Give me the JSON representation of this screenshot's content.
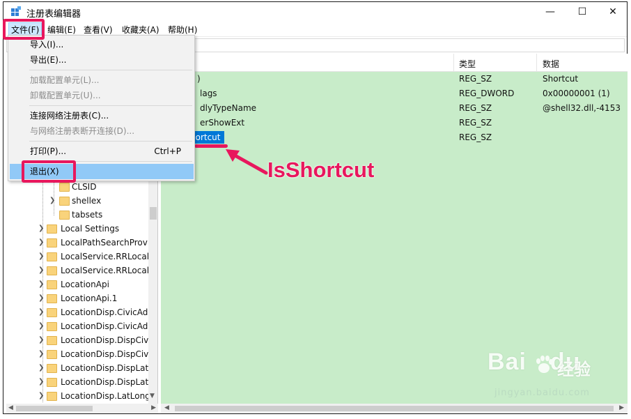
{
  "window": {
    "title": "注册表编辑器",
    "controls": {
      "minimize": "—",
      "maximize": "☐",
      "close": "✕"
    }
  },
  "menubar": {
    "items": [
      "文件(F)",
      "编辑(E)",
      "查看(V)",
      "收藏夹(A)",
      "帮助(H)"
    ]
  },
  "file_menu": {
    "items": [
      {
        "label": "导入(I)...",
        "enabled": true
      },
      {
        "label": "导出(E)...",
        "enabled": true
      },
      {
        "label": "加载配置单元(L)...",
        "enabled": false
      },
      {
        "label": "卸载配置单元(U)...",
        "enabled": false
      },
      {
        "label": "连接网络注册表(C)...",
        "enabled": true
      },
      {
        "label": "与网络注册表断开连接(D)...",
        "enabled": false
      },
      {
        "label": "打印(P)...",
        "enabled": true,
        "shortcut": "Ctrl+P"
      },
      {
        "label": "退出(X)",
        "enabled": true,
        "highlighted": true
      }
    ]
  },
  "tree": {
    "items": [
      "CLSID",
      "shellex",
      "tabsets",
      "Local Settings",
      "LocalPathSearchProvi",
      "LocalService.RRLocalS",
      "LocalService.RRLocalS",
      "LocationApi",
      "LocationApi.1",
      "LocationDisp.CivicAdc",
      "LocationDisp.CivicAdc",
      "LocationDisp.DispCivi",
      "LocationDisp.DispCivi",
      "LocationDisp.DispLatL",
      "LocationDisp.DispLatL",
      "LocationDisp.LatLong"
    ]
  },
  "values": {
    "columns": {
      "type": "类型",
      "data": "数据"
    },
    "rows": [
      {
        "name_fragment": ")",
        "type": "REG_SZ",
        "data": "Shortcut"
      },
      {
        "name_fragment": "lags",
        "type": "REG_DWORD",
        "data": "0x00000001 (1)"
      },
      {
        "name_fragment": "dlyTypeName",
        "type": "REG_SZ",
        "data": "@shell32.dll,-4153"
      },
      {
        "name_fragment": "erShowExt",
        "type": "REG_SZ",
        "data": ""
      },
      {
        "name_fragment": "hortcut",
        "type": "REG_SZ",
        "data": ""
      }
    ]
  },
  "annotation": {
    "label": "IsShortcut",
    "color": "#e8175d"
  },
  "watermark": {
    "logo": "Bai",
    "logo_tail": "du",
    "cn": "经验",
    "url": "jingyan.baidu.com"
  },
  "colors": {
    "values_bg": "#c8ecc9",
    "selection": "#0078d7",
    "menu_highlight": "#91c9f7"
  }
}
